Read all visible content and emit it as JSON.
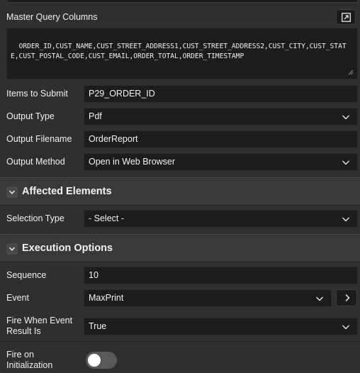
{
  "master_query": {
    "label": "Master Query Columns",
    "value": "ORDER_ID,CUST_NAME,CUST_STREET_ADDRESS1,CUST_STREET_ADDRESS2,CUST_CITY,CUST_STATE,CUST_POSTAL_CODE,CUST_EMAIL,ORDER_TOTAL,ORDER_TIMESTAMP"
  },
  "items_to_submit": {
    "label": "Items to Submit",
    "value": "P29_ORDER_ID"
  },
  "output_type": {
    "label": "Output Type",
    "value": "Pdf"
  },
  "output_filename": {
    "label": "Output Filename",
    "value": "OrderReport"
  },
  "output_method": {
    "label": "Output Method",
    "value": "Open in Web Browser"
  },
  "affected_elements": {
    "title": "Affected Elements",
    "selection_type": {
      "label": "Selection Type",
      "value": "- Select -"
    }
  },
  "execution_options": {
    "title": "Execution Options",
    "sequence": {
      "label": "Sequence",
      "value": "10"
    },
    "event": {
      "label": "Event",
      "value": "MaxPrint"
    },
    "fire_when": {
      "label_line1": "Fire When Event",
      "label_line2": "Result Is",
      "value": "True"
    },
    "fire_on_init": {
      "label_line1": "Fire on",
      "label_line2": "Initialization",
      "value": "Off"
    }
  },
  "icons": {
    "expand": "expand-icon",
    "chevron": "chevron-down-icon",
    "collapse": "chevron-down-icon",
    "next": "chevron-right-icon"
  }
}
